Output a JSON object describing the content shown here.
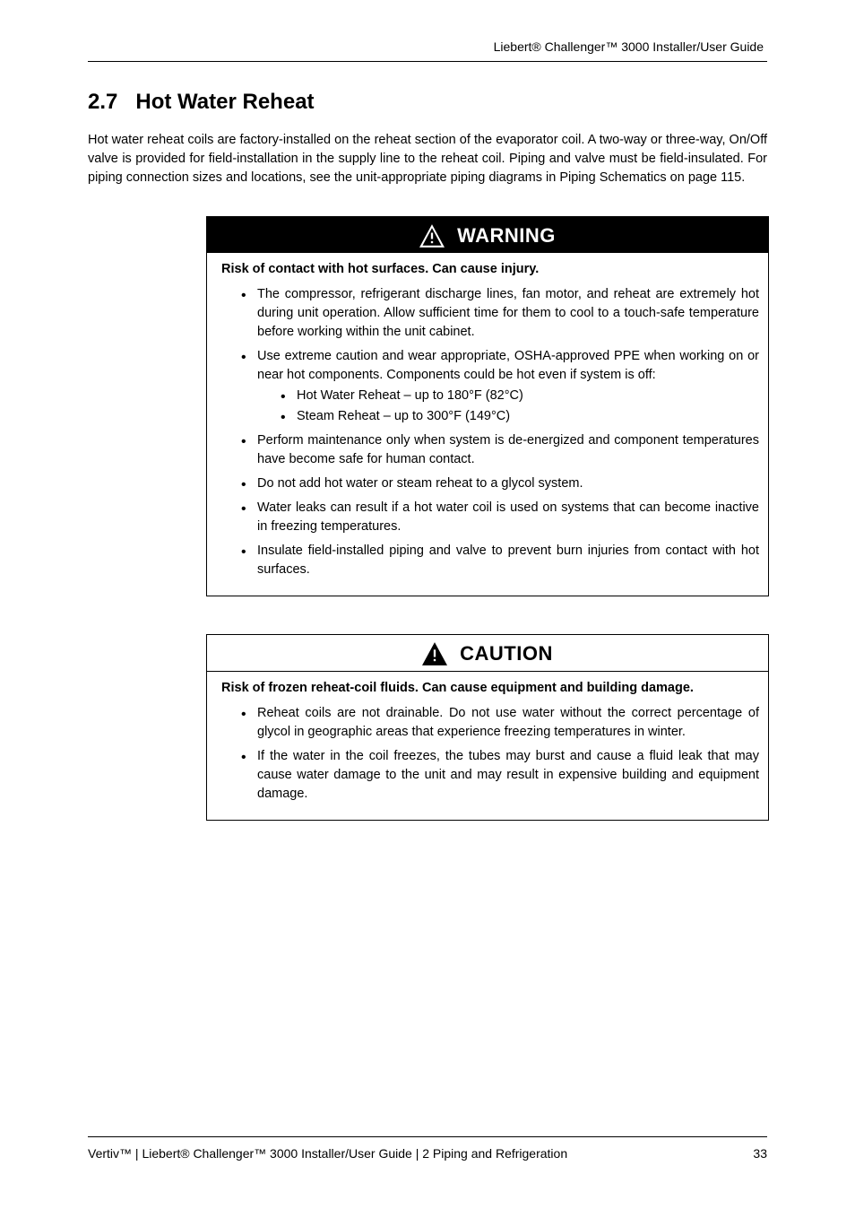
{
  "header": {
    "product": "Liebert® Challenger™ 3000",
    "subtitle": "Installer/User Guide"
  },
  "section": {
    "number": "2.7",
    "title": "Hot Water Reheat"
  },
  "intro": "Hot water reheat coils are factory-installed on the reheat section of the evaporator coil. A two-way or three-way, On/Off valve is provided for field-installation in the supply line to the reheat coil. Piping and valve must be field-insulated. For piping connection sizes and locations, see the unit-appropriate piping diagrams in Piping Schematics on page 115.",
  "warning": {
    "label": "WARNING",
    "sub": "Risk of contact with hot surfaces. Can cause injury.",
    "items": [
      "The compressor, refrigerant discharge lines, fan motor, and reheat are extremely hot during unit operation. Allow sufficient time for them to cool to a touch-safe temperature before working within the unit cabinet.",
      "Use extreme caution and wear appropriate, OSHA-approved PPE when working on or near hot components. Components could be hot even if system is off:",
      "Hot Water Reheat – up to 180°F (82°C)",
      "Steam Reheat – up to 300°F (149°C)",
      "Perform maintenance only when system is de-energized and component temperatures have become safe for human contact.",
      "Do not add hot water or steam reheat to a glycol system.",
      "Water leaks can result if a hot water coil is used on systems that can become inactive in freezing temperatures.",
      "Insulate field-installed piping and valve to prevent burn injuries from contact with hot surfaces."
    ],
    "subIndices": [
      2,
      3
    ]
  },
  "caution": {
    "label": "CAUTION",
    "sub": "Risk of frozen reheat-coil fluids. Can cause equipment and building damage.",
    "items": [
      "Reheat coils are not drainable. Do not use water without the correct percentage of glycol in geographic areas that experience freezing temperatures in winter.",
      "If the water in the coil freezes, the tubes may burst and cause a fluid leak that may cause water damage to the unit and may result in expensive building and equipment damage."
    ]
  },
  "footer": {
    "company": "Vertiv™",
    "product": "Liebert® Challenger™ 3000",
    "subtitle": "Installer/User Guide",
    "section": "2 Piping and Refrigeration",
    "page": "33"
  }
}
